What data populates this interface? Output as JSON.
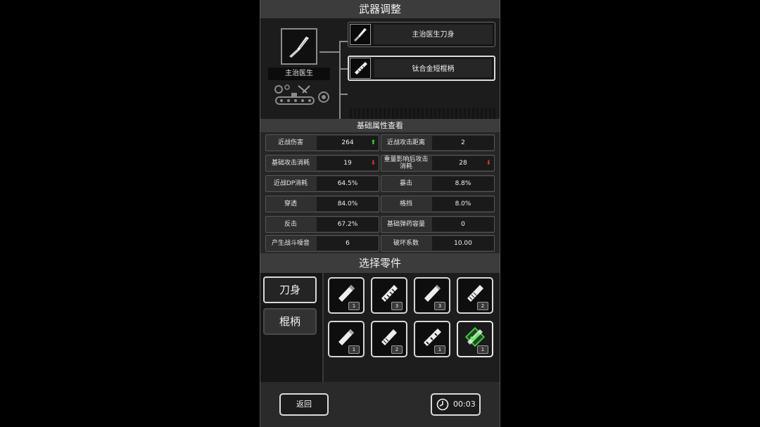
{
  "header": {
    "title": "武器调整"
  },
  "weapon": {
    "name": "主治医生",
    "parts": [
      {
        "label": "主治医生刀身",
        "icon": "scalpel-blade-icon",
        "selected": false
      },
      {
        "label": "钛合金短棍柄",
        "icon": "handle-icon",
        "selected": true
      },
      {
        "label": "—",
        "empty": true
      }
    ]
  },
  "stats": {
    "title": "基础属性查看",
    "rows": [
      [
        {
          "name": "近战伤害",
          "value": "264",
          "trend": "up"
        },
        {
          "name": "近战攻击距离",
          "value": "2"
        }
      ],
      [
        {
          "name": "基础攻击消耗",
          "value": "19",
          "trend": "down"
        },
        {
          "name": "重量影响后攻击消耗",
          "value": "28",
          "trend": "down"
        }
      ],
      [
        {
          "name": "近战DP消耗",
          "value": "64.5%"
        },
        {
          "name": "暴击",
          "value": "8.8%"
        }
      ],
      [
        {
          "name": "穿透",
          "value": "84.0%"
        },
        {
          "name": "格挡",
          "value": "8.0%"
        }
      ],
      [
        {
          "name": "反击",
          "value": "67.2%"
        },
        {
          "name": "基础弹药容量",
          "value": "0"
        }
      ],
      [
        {
          "name": "产生战斗噪音",
          "value": "6"
        },
        {
          "name": "破坏系数",
          "value": "10.00"
        }
      ]
    ]
  },
  "select": {
    "title": "选择零件",
    "categories": [
      {
        "label": "刀身",
        "active": true
      },
      {
        "label": "棍柄",
        "active": false
      }
    ],
    "parts": [
      {
        "icon": "handle-plain-icon",
        "count": "1"
      },
      {
        "icon": "handle-wrapped-icon",
        "count": "3"
      },
      {
        "icon": "handle-plain-icon",
        "count": "3"
      },
      {
        "icon": "handle-grip-icon",
        "count": "2"
      },
      {
        "icon": "handle-plain-icon",
        "count": "1"
      },
      {
        "icon": "handle-grip-icon",
        "count": "2"
      },
      {
        "icon": "handle-wrapped-icon",
        "count": "1"
      },
      {
        "icon": "equipped-handle-icon",
        "count": "1",
        "equipped": true
      }
    ]
  },
  "footer": {
    "back_label": "返回",
    "timer": "00:03",
    "timer_icon": "clock-icon"
  },
  "colors": {
    "up": "#3adb3a",
    "down": "#e03030",
    "equipped": "#3cc83c"
  }
}
